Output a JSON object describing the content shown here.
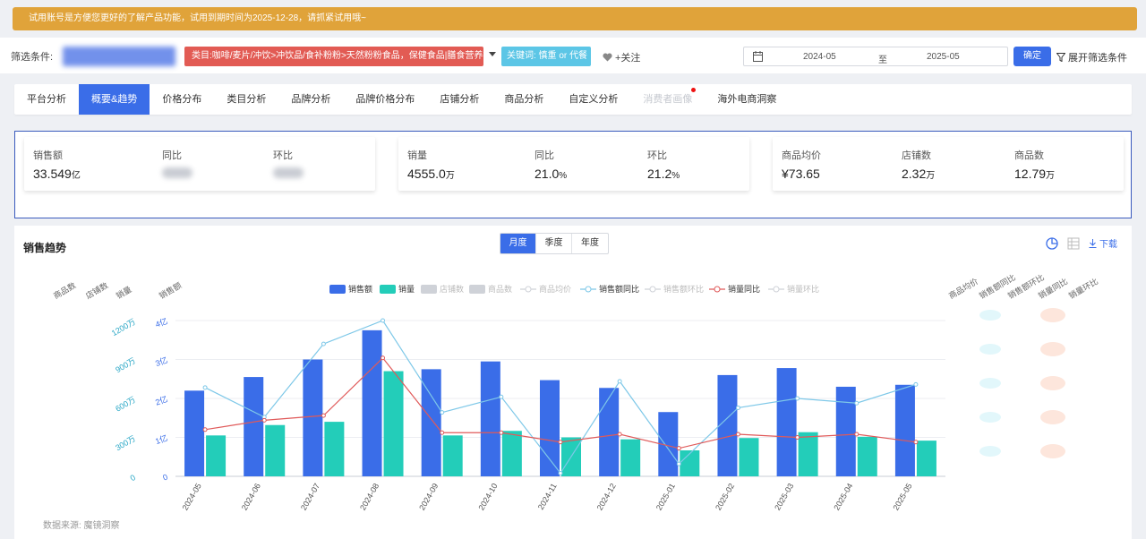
{
  "notice": {
    "text": "试用账号是方便您更好的了解产品功能，试用到期时间为2025-12-28，请抓紧试用哦~"
  },
  "filter": {
    "label": "筛选条件:",
    "category_tag": "类目:咖啡/麦片/冲饮>冲饮品/食补粉粉>天然粉粉食品，保健食品|膳食营养补充食品",
    "keyword_tag": "关键词: 慎重 or 代餐",
    "follow_label": "+关注",
    "date_start": "2024-05",
    "date_to": "至",
    "date_end": "2025-05",
    "confirm_label": "确定",
    "expand_label": "展开筛选条件"
  },
  "tabs": [
    {
      "label": "平台分析"
    },
    {
      "label": "概要&趋势"
    },
    {
      "label": "价格分布"
    },
    {
      "label": "类目分析"
    },
    {
      "label": "品牌分析"
    },
    {
      "label": "品牌价格分布"
    },
    {
      "label": "店铺分析"
    },
    {
      "label": "商品分析"
    },
    {
      "label": "自定义分析"
    },
    {
      "label": "消费者画像"
    },
    {
      "label": "海外电商洞察"
    }
  ],
  "kpi": {
    "sales_amount": {
      "label": "销售额",
      "value": "33.549",
      "unit": "亿"
    },
    "sales_yoy": {
      "label": "同比"
    },
    "sales_mom": {
      "label": "环比"
    },
    "volume": {
      "label": "销量",
      "value": "4555.0",
      "unit": "万"
    },
    "volume_yoy": {
      "label": "同比",
      "value": "21.0",
      "unit": "%"
    },
    "volume_mom": {
      "label": "环比",
      "value": "21.2",
      "unit": "%"
    },
    "avg_price": {
      "label": "商品均价",
      "value": "¥73.65"
    },
    "shops": {
      "label": "店铺数",
      "value": "2.32",
      "unit": "万"
    },
    "items": {
      "label": "商品数",
      "value": "12.79",
      "unit": "万"
    }
  },
  "chart_panel": {
    "title": "销售趋势",
    "periods": [
      "月度",
      "季度",
      "年度"
    ],
    "download_label": "下载",
    "source": "数据来源: 魔镜洞察"
  },
  "colors": {
    "primary": "#3a6de8",
    "bar_volume": "#23cdb9",
    "yoy_line": "#7ec8e8",
    "vol_yoy_line": "#e05a5a",
    "notice": "#e0a33a"
  },
  "chart_data": {
    "type": "bar",
    "categories": [
      "2024-05",
      "2024-06",
      "2024-07",
      "2024-08",
      "2024-09",
      "2024-10",
      "2024-11",
      "2024-12",
      "2025-01",
      "2025-02",
      "2025-03",
      "2025-04",
      "2025-05"
    ],
    "legend": [
      "销售额",
      "销量",
      "店铺数",
      "商品数",
      "商品均价",
      "销售额同比",
      "销售额环比",
      "销量同比",
      "销量环比"
    ],
    "left_axis_labels": [
      "商品数",
      "店铺数",
      "销量",
      "销售额"
    ],
    "right_axis_labels": [
      "商品均价",
      "销售额同比",
      "销售额环比",
      "销量同比",
      "销量环比"
    ],
    "sales_ticks": [
      "0",
      "1亿",
      "2亿",
      "3亿",
      "4亿"
    ],
    "volume_ticks": [
      "0",
      "300万",
      "600万",
      "900万",
      "1200万"
    ],
    "sales_ylim": [
      0,
      4
    ],
    "volume_ylim": [
      0,
      1200
    ],
    "series": [
      {
        "name": "销售额",
        "axis": "sales",
        "values": [
          2.2,
          2.55,
          3.0,
          3.75,
          2.75,
          2.95,
          2.47,
          2.27,
          1.65,
          2.6,
          2.78,
          2.3,
          2.35
        ]
      },
      {
        "name": "销量",
        "axis": "volume",
        "values": [
          315,
          395,
          420,
          810,
          315,
          350,
          300,
          285,
          200,
          295,
          340,
          305,
          275
        ]
      },
      {
        "name": "销售额同比",
        "axis": "right",
        "values": [
          0.57,
          0.38,
          0.85,
          1.0,
          0.41,
          0.51,
          0.02,
          0.61,
          0.08,
          0.44,
          0.5,
          0.47,
          0.59
        ]
      },
      {
        "name": "销量同比",
        "axis": "right",
        "values": [
          0.3,
          0.36,
          0.39,
          0.76,
          0.28,
          0.28,
          0.22,
          0.27,
          0.18,
          0.27,
          0.25,
          0.27,
          0.22
        ]
      }
    ],
    "legend_disabled": [
      "店铺数",
      "商品数",
      "商品均价",
      "销售额环比",
      "销量环比"
    ]
  }
}
